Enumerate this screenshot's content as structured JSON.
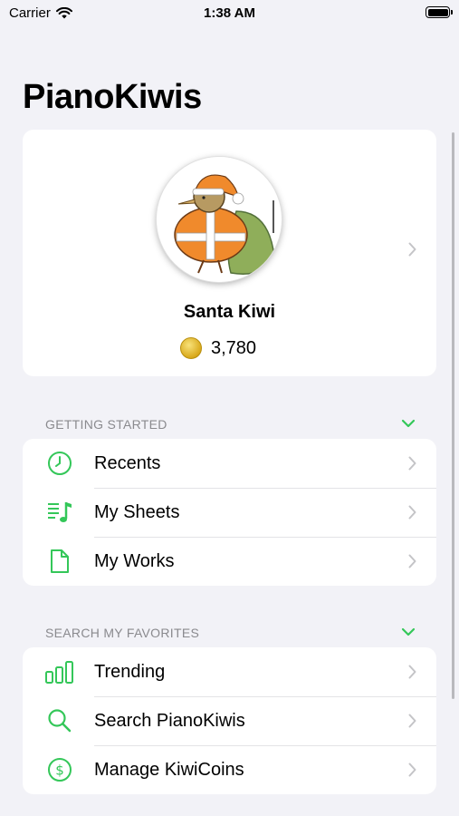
{
  "status_bar": {
    "carrier": "Carrier",
    "time": "1:38 AM"
  },
  "page_title": "PianoKiwis",
  "profile": {
    "name": "Santa Kiwi",
    "coins": "3,780"
  },
  "sections": [
    {
      "header": "GETTING STARTED",
      "items": [
        {
          "label": "Recents",
          "icon": "clock-icon"
        },
        {
          "label": "My Sheets",
          "icon": "music-list-icon"
        },
        {
          "label": "My Works",
          "icon": "document-icon"
        }
      ]
    },
    {
      "header": "SEARCH MY FAVORITES",
      "items": [
        {
          "label": "Trending",
          "icon": "bar-chart-icon"
        },
        {
          "label": "Search PianoKiwis",
          "icon": "search-icon"
        },
        {
          "label": "Manage KiwiCoins",
          "icon": "dollar-circle-icon"
        }
      ]
    }
  ],
  "colors": {
    "accent": "#34c759",
    "background": "#f2f2f7",
    "card": "#ffffff",
    "chevron": "#c4c4c7",
    "header": "#8a8a8e"
  }
}
